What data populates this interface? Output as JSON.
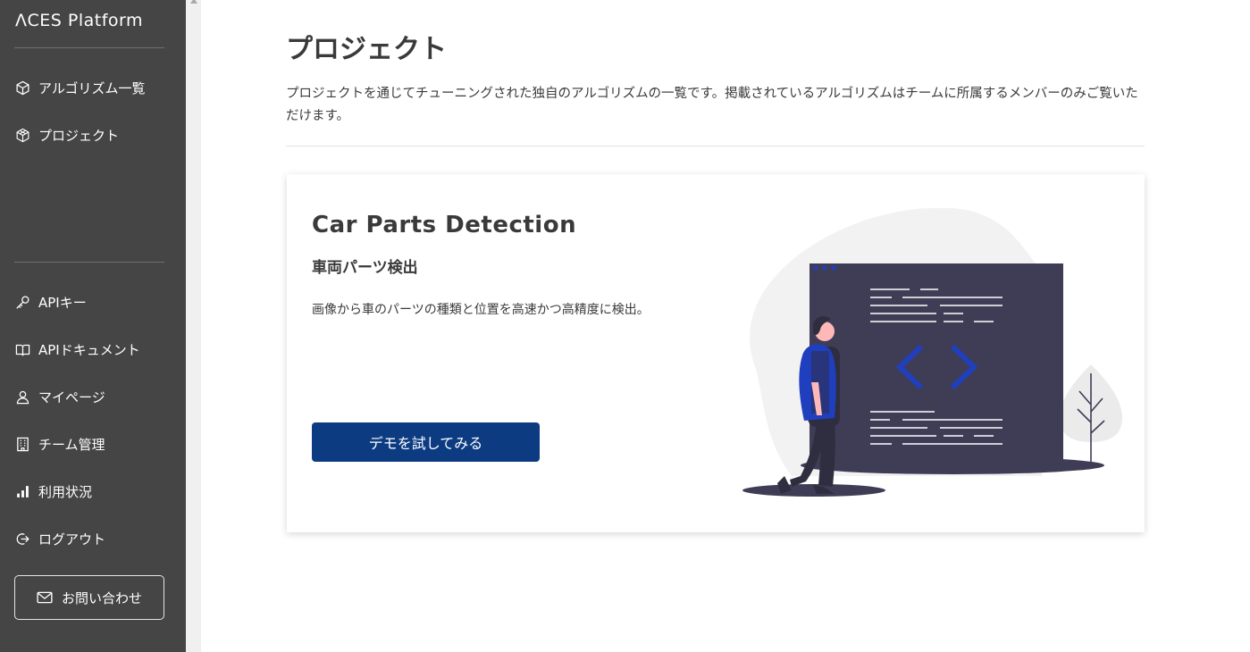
{
  "sidebar": {
    "logo": "ΛCES Platform",
    "nav_top": [
      {
        "label": "アルゴリズム一覧",
        "icon": "cube-icon"
      },
      {
        "label": "プロジェクト",
        "icon": "cubes-icon"
      }
    ],
    "nav_bottom": [
      {
        "label": "APIキー",
        "icon": "key-icon"
      },
      {
        "label": "APIドキュメント",
        "icon": "book-icon"
      },
      {
        "label": "マイページ",
        "icon": "user-icon"
      },
      {
        "label": "チーム管理",
        "icon": "building-icon"
      },
      {
        "label": "利用状況",
        "icon": "bar-chart-icon"
      },
      {
        "label": "ログアウト",
        "icon": "logout-icon"
      }
    ],
    "contact_label": "お問い合わせ"
  },
  "main": {
    "title": "プロジェクト",
    "description": "プロジェクトを通じてチューニングされた独自のアルゴリズムの一覧です。掲載されているアルゴリズムはチームに所属するメンバーのみご覧いただけます。",
    "card": {
      "title": "Car Parts Detection",
      "subtitle": "車両パーツ検出",
      "description": "画像から車のパーツの種類と位置を高速かつ高精度に検出。",
      "button_label": "デモを試してみる",
      "illustration": "developer-code-illustration"
    }
  },
  "colors": {
    "sidebar_bg": "#454545",
    "accent": "#0c3b82",
    "illustration_screen": "#3f3d56",
    "illustration_accent": "#1f3fbe"
  }
}
